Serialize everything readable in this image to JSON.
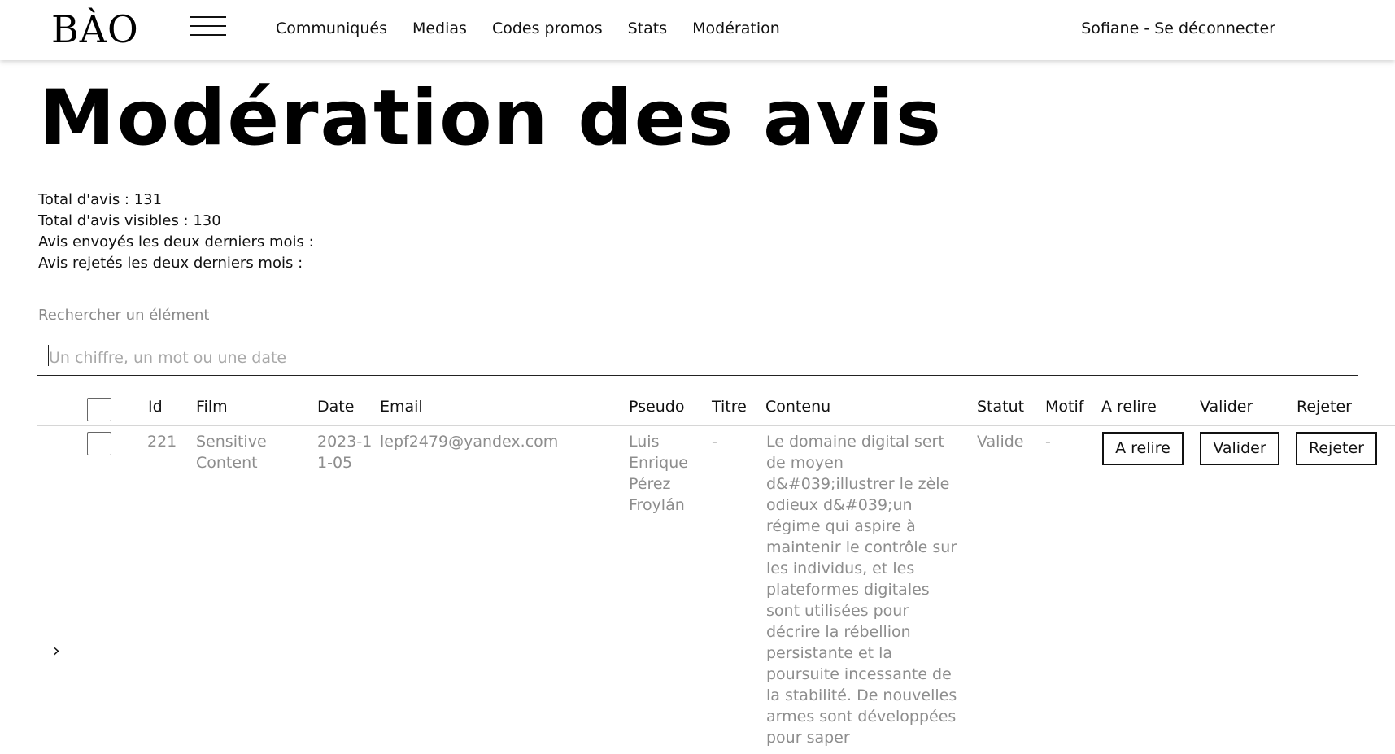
{
  "header": {
    "logo": "BÀO",
    "nav": [
      "Communiqués",
      "Medias",
      "Codes promos",
      "Stats",
      "Modération"
    ],
    "user_link": "Sofiane - Se déconnecter"
  },
  "page": {
    "title": "Modération des avis",
    "stats": [
      "Total d'avis : 131",
      "Total d'avis visibles : 130",
      "Avis envoyés les deux derniers mois :",
      "Avis rejetés les deux derniers mois :"
    ]
  },
  "search": {
    "label": "Rechercher un élément",
    "placeholder": "Un chiffre, un mot ou une date",
    "value": ""
  },
  "table": {
    "columns": [
      "Id",
      "Film",
      "Date",
      "Email",
      "Pseudo",
      "Titre",
      "Contenu",
      "Statut",
      "Motif",
      "A relire",
      "Valider",
      "Rejeter"
    ],
    "rows": [
      {
        "id": "221",
        "film": "Sensitive Content",
        "date": "2023-11-05",
        "email": "lepf2479@yandex.com",
        "pseudo": "Luis Enrique Pérez Froylán",
        "titre": "-",
        "contenu": "Le domaine digital sert de moyen d&#039;illustrer le zèle odieux d&#039;un régime qui aspire à maintenir le contrôle sur les individus, et les plateformes digitales sont utilisées pour décrire la rébellion persistante et la poursuite incessante de la stabilité. De nouvelles armes sont développées pour saper",
        "statut": "Valide",
        "motif": "-",
        "btn_relire": "A relire",
        "btn_valider": "Valider",
        "btn_rejeter": "Rejeter"
      }
    ]
  }
}
